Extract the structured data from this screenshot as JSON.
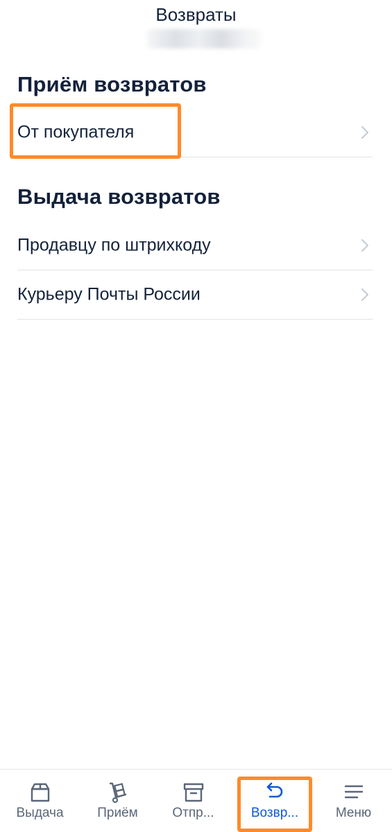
{
  "header": {
    "title": "Возвраты"
  },
  "sections": [
    {
      "heading": "Приём возвратов",
      "items": [
        {
          "label": "От покупателя"
        }
      ]
    },
    {
      "heading": "Выдача возвратов",
      "items": [
        {
          "label": "Продавцу по штрихкоду"
        },
        {
          "label": "Курьеру Почты России"
        }
      ]
    }
  ],
  "bottom_nav": {
    "tabs": [
      {
        "label": "Выдача",
        "icon": "box-icon",
        "active": false
      },
      {
        "label": "Приём",
        "icon": "hand-truck-icon",
        "active": false
      },
      {
        "label": "Отпр...",
        "icon": "archive-icon",
        "active": false
      },
      {
        "label": "Возвр...",
        "icon": "return-arrow-icon",
        "active": true
      },
      {
        "label": "Меню",
        "icon": "menu-icon",
        "active": false
      }
    ]
  },
  "colors": {
    "text_primary": "#14233a",
    "accent_active": "#0b5bd7",
    "nav_inactive": "#5a6678",
    "highlight": "#ff8a2a",
    "divider": "#dfe3e8"
  }
}
